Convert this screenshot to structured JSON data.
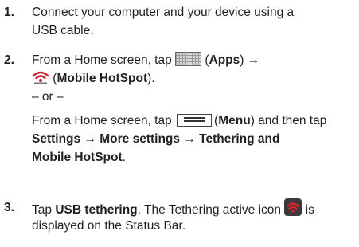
{
  "steps": [
    {
      "number": "1.",
      "lines": [
        "Connect your computer and your device using a",
        "USB cable."
      ]
    },
    {
      "number": "2.",
      "line1_pre": "From a Home screen, tap",
      "apps_label": "Apps",
      "arrow": "→",
      "hotspot_label": "Mobile HotSpot",
      "or_text": "– or –",
      "alt_pre": "From a Home screen, tap",
      "menu_label": "Menu",
      "alt_post": "and then tap",
      "path_line1": "Settings → More settings → Tethering and",
      "path_line2": "Mobile HotSpot"
    },
    {
      "number": "3.",
      "pre": "Tap",
      "usb_label": "USB tethering",
      "mid": ". The Tethering active icon",
      "post": "is",
      "line2": "displayed on the Status Bar."
    }
  ],
  "icons": {
    "apps": "apps-grid-icon",
    "hotspot": "mobile-hotspot-icon",
    "menu": "menu-icon",
    "tethering": "tethering-active-icon"
  },
  "colors": {
    "text": "#231f20",
    "hotspot_red": "#c8202f"
  }
}
